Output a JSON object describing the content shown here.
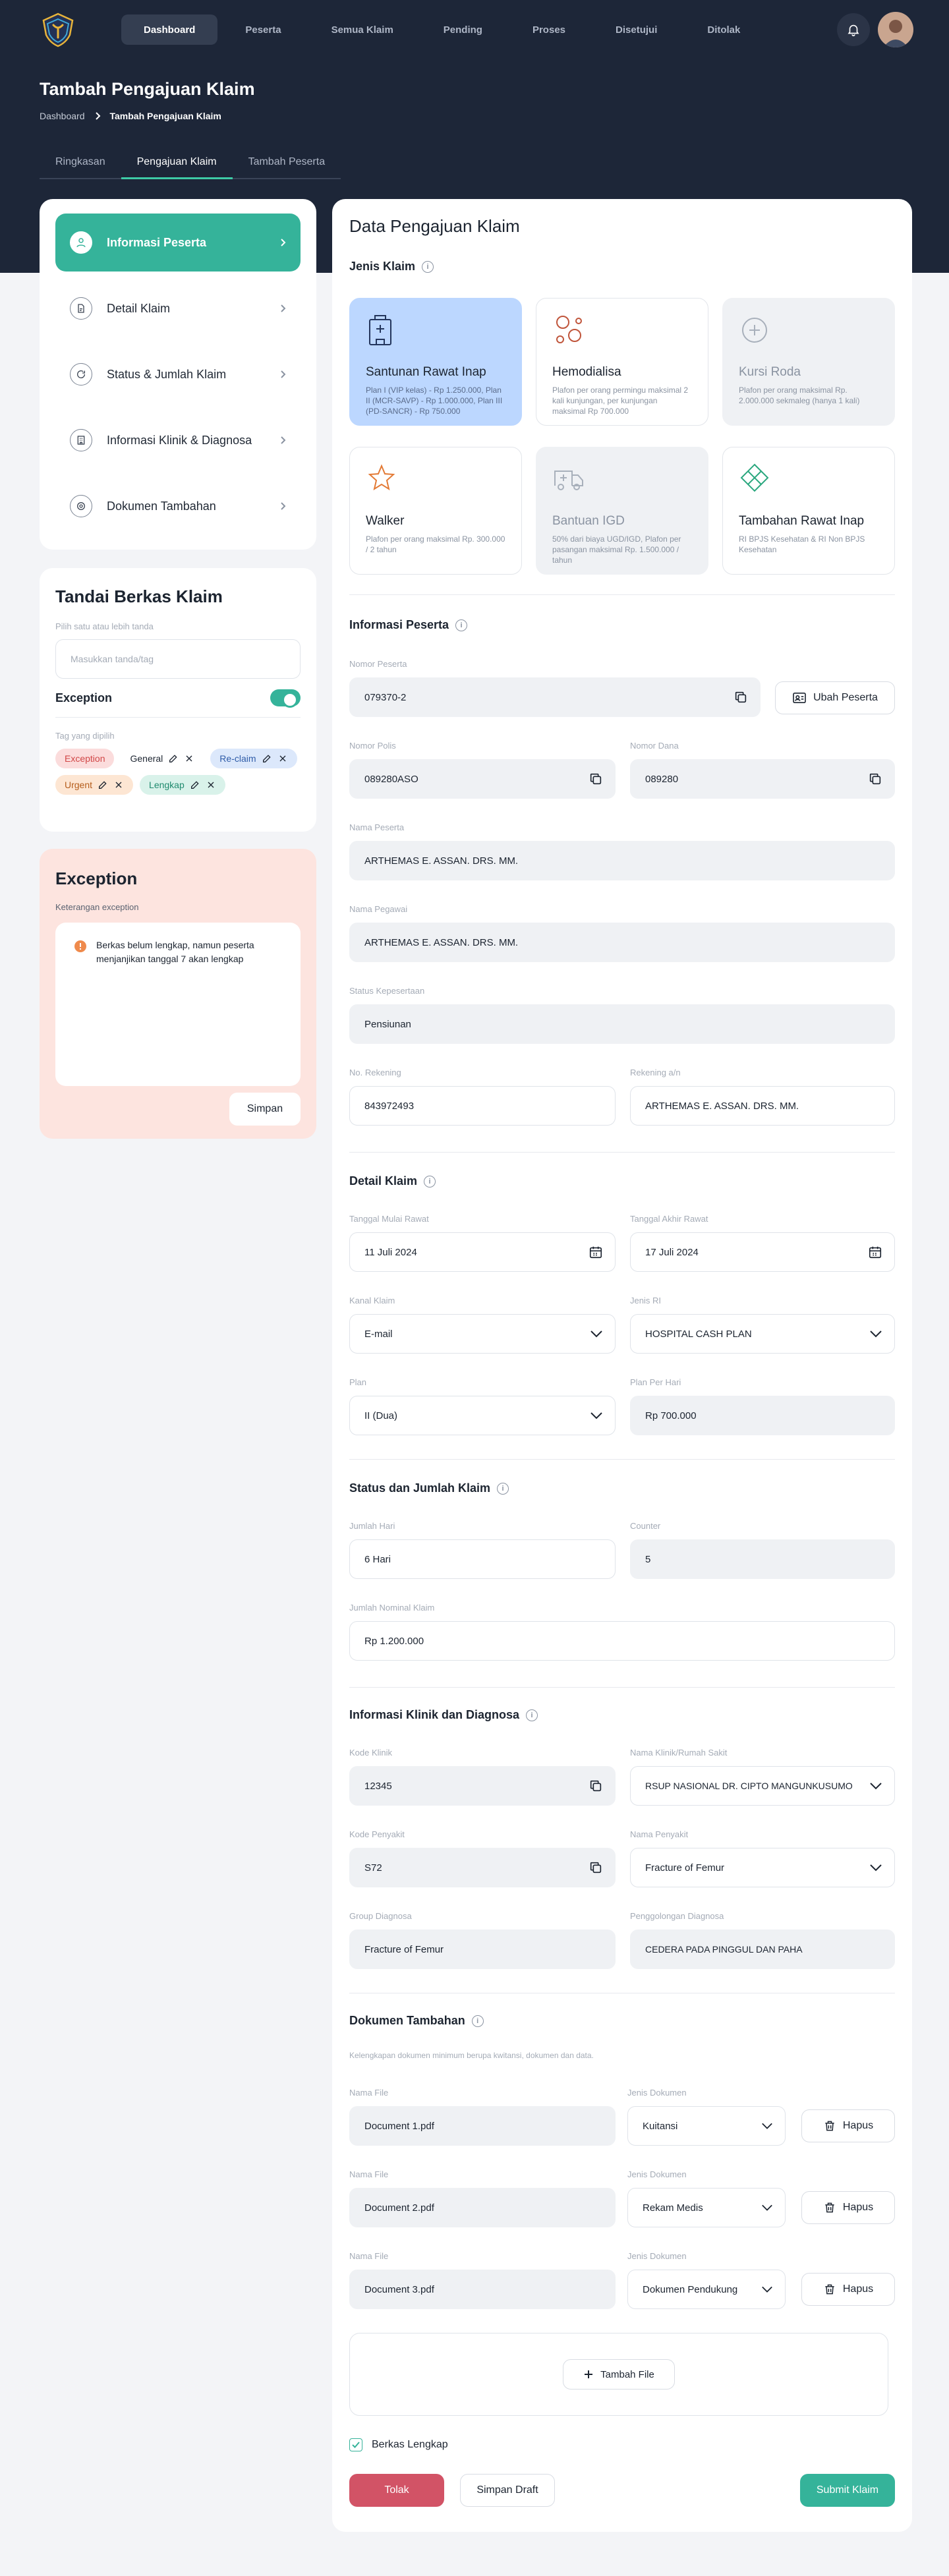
{
  "nav": {
    "items": [
      "Dashboard",
      "Peserta",
      "Semua Klaim",
      "Pending",
      "Proses",
      "Disetujui",
      "Ditolak"
    ],
    "active": "Dashboard"
  },
  "header": {
    "title": "Tambah Pengajuan Klaim",
    "breadcrumb": [
      "Dashboard",
      "Tambah Pengajuan Klaim"
    ]
  },
  "tabs": [
    "Ringkasan",
    "Pengajuan Klaim",
    "Tambah Peserta"
  ],
  "steps": [
    "Informasi Peserta",
    "Detail Klaim",
    "Status & Jumlah Klaim",
    "Informasi Klinik & Diagnosa",
    "Dokumen Tambahan"
  ],
  "tandai": {
    "title": "Tandai Berkas Klaim",
    "hint": "Pilih satu atau lebih tanda",
    "placeholder": "Masukkan tanda/tag",
    "exception_label": "Exception",
    "selected_label": "Tag yang dipilih",
    "tags": [
      "Exception",
      "General",
      "Re-claim",
      "Urgent",
      "Lengkap"
    ]
  },
  "exception": {
    "title": "Exception",
    "label": "Keterangan exception",
    "note": "Berkas belum lengkap, namun peserta menjanjikan tanggal 7 akan lengkap",
    "save": "Simpan"
  },
  "main": {
    "title": "Data Pengajuan Klaim",
    "jenis_title": "Jenis Klaim",
    "jenis": [
      {
        "title": "Santunan Rawat Inap",
        "desc": "Plan I (VIP kelas) - Rp 1.250.000, Plan II (MCR-SAVP) - Rp 1.000.000, Plan III (PD-SANCR) - Rp 750.000"
      },
      {
        "title": "Hemodialisa",
        "desc": "Plafon per orang permingu maksimal 2 kali kunjungan, per kunjungan maksimal Rp 700.000"
      },
      {
        "title": "Kursi Roda",
        "desc": "Plafon per orang maksimal Rp. 2.000.000 sekmaleg (hanya 1 kali)"
      },
      {
        "title": "Walker",
        "desc": "Plafon per orang maksimal Rp. 300.000 / 2 tahun"
      },
      {
        "title": "Bantuan IGD",
        "desc": "50% dari biaya UGD/IGD, Plafon per pasangan maksimal Rp. 1.500.000 / tahun"
      },
      {
        "title": "Tambahan Rawat Inap",
        "desc": "RI BPJS Kesehatan & RI Non BPJS Kesehatan"
      }
    ],
    "peserta_title": "Informasi Peserta",
    "nomor_peserta_label": "Nomor Peserta",
    "nomor_peserta": "079370-2",
    "ubah_peserta": "Ubah Peserta",
    "nomor_polis_label": "Nomor Polis",
    "nomor_polis": "089280ASO",
    "nomor_dana_label": "Nomor Dana",
    "nomor_dana": "089280",
    "nama_peserta_label": "Nama Peserta",
    "nama_peserta": "ARTHEMAS E. ASSAN. DRS. MM.",
    "nama_pegawai_label": "Nama Pegawai",
    "nama_pegawai": "ARTHEMAS E. ASSAN. DRS. MM.",
    "status_label": "Status Kepesertaan",
    "status": "Pensiunan",
    "rekening_label": "No. Rekening",
    "rekening": "843972493",
    "rekening_an_label": "Rekening a/n",
    "rekening_an": "ARTHEMAS E. ASSAN. DRS. MM.",
    "detail_title": "Detail Klaim",
    "tgl_mulai_label": "Tanggal Mulai Rawat",
    "tgl_mulai": "11 Juli 2024",
    "tgl_akhir_label": "Tanggal Akhir Rawat",
    "tgl_akhir": "17 Juli 2024",
    "kanal_label": "Kanal Klaim",
    "kanal": "E-mail",
    "jenis_ri_label": "Jenis RI",
    "jenis_ri": "HOSPITAL CASH PLAN",
    "plan_label": "Plan",
    "plan": "II (Dua)",
    "plan_hari_label": "Plan Per Hari",
    "plan_hari": "Rp 700.000",
    "status_jumlah_title": "Status dan Jumlah Klaim",
    "jumlah_hari_label": "Jumlah Hari",
    "jumlah_hari": "6 Hari",
    "counter_label": "Counter",
    "counter": "5",
    "nominal_label": "Jumlah Nominal Klaim",
    "nominal": "Rp 1.200.000",
    "klinik_title": "Informasi Klinik dan Diagnosa",
    "kode_klinik_label": "Kode Klinik",
    "kode_klinik": "12345",
    "nama_klinik_label": "Nama Klinik/Rumah Sakit",
    "nama_klinik": "RSUP NASIONAL DR. CIPTO MANGUNKUSUMO",
    "kode_penyakit_label": "Kode Penyakit",
    "kode_penyakit": "S72",
    "nama_penyakit_label": "Nama Penyakit",
    "nama_penyakit": "Fracture of Femur",
    "group_label": "Group Diagnosa",
    "group": "Fracture of Femur",
    "penggolongan_label": "Penggolongan Diagnosa",
    "penggolongan": "CEDERA PADA PINGGUL DAN PAHA",
    "dokumen_title": "Dokumen Tambahan",
    "dokumen_hint": "Kelengkapan dokumen minimum berupa kwitansi, dokumen dan data.",
    "nama_file_label": "Nama File",
    "jenis_dokumen_label": "Jenis Dokumen",
    "hapus": "Hapus",
    "files": [
      {
        "name": "Document 1.pdf",
        "type": "Kuitansi"
      },
      {
        "name": "Document 2.pdf",
        "type": "Rekam Medis"
      },
      {
        "name": "Document 3.pdf",
        "type": "Dokumen Pendukung"
      }
    ],
    "tambah_file": "Tambah File",
    "berkas_lengkap": "Berkas Lengkap",
    "tolak": "Tolak",
    "simpan_draft": "Simpan Draft",
    "submit": "Submit Klaim"
  },
  "colors": {
    "accent": "#35b39a",
    "header_bg": "#1d2638",
    "danger": "#d25366",
    "exception_bg": "#fde4df"
  }
}
